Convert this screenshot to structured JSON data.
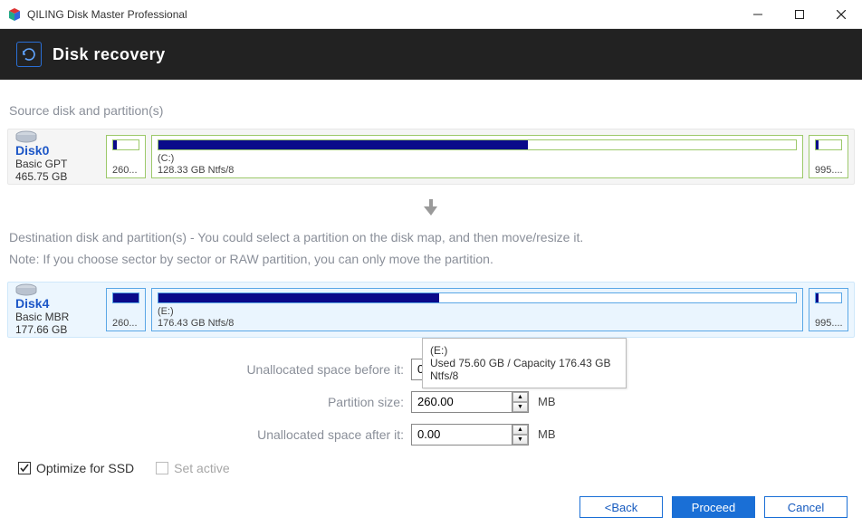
{
  "app": {
    "title": "QILING Disk Master Professional"
  },
  "header": {
    "title": "Disk recovery"
  },
  "section1_label": "Source disk and partition(s)",
  "source_disk": {
    "name": "Disk0",
    "type": "Basic GPT",
    "size": "465.75 GB",
    "parts": [
      {
        "fill_pct": 14,
        "l1": "",
        "l2": "260..."
      },
      {
        "fill_pct": 58,
        "l1": "(C:)",
        "l2": "128.33 GB Ntfs/8"
      },
      {
        "fill_pct": 10,
        "l1": "",
        "l2": "995...."
      }
    ]
  },
  "section2_label": "Destination disk and partition(s) - You could select a partition on the disk map, and then move/resize it.",
  "section2_note": "Note: If you choose sector by sector or RAW partition, you can only move the partition.",
  "dest_disk": {
    "name": "Disk4",
    "type": "Basic MBR",
    "size": "177.66 GB",
    "parts": [
      {
        "fill_pct": 100,
        "l1": "",
        "l2": "260..."
      },
      {
        "fill_pct": 44,
        "l1": "(E:)",
        "l2": "176.43 GB Ntfs/8"
      },
      {
        "fill_pct": 10,
        "l1": "",
        "l2": "995...."
      }
    ]
  },
  "form": {
    "before_label": "Unallocated space before it:",
    "size_label": "Partition size:",
    "after_label": "Unallocated space after it:",
    "before_value": "0",
    "size_value": "260.00",
    "after_value": "0.00",
    "unit": "MB"
  },
  "tooltip": {
    "line1": "(E:)",
    "line2": "Used 75.60 GB / Capacity 176.43 GB",
    "line3": "Ntfs/8"
  },
  "checks": {
    "ssd": "Optimize for SSD",
    "active": "Set active"
  },
  "footer": {
    "back": "<Back",
    "proceed": "Proceed",
    "cancel": "Cancel"
  }
}
